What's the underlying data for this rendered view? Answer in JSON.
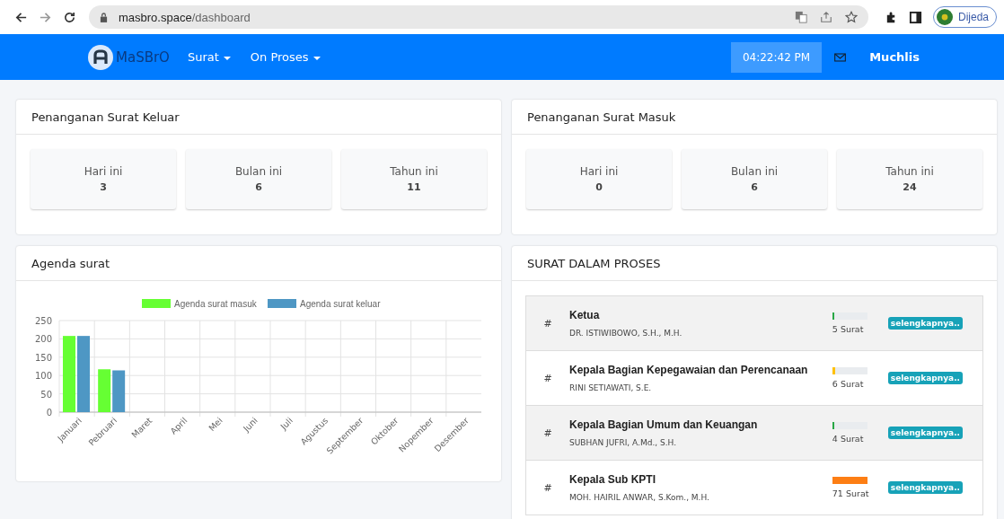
{
  "browser": {
    "url_host": "masbro.space",
    "url_path": "/dashboard",
    "profile": "Dijeda"
  },
  "navbar": {
    "brand": "MaSBrO",
    "menus": [
      "Surat",
      "On Proses"
    ],
    "clock": "04:22:42 PM",
    "user": "Muchlis"
  },
  "stat_cards": [
    {
      "title": "Penanganan Surat Keluar",
      "stats": [
        {
          "label": "Hari ini",
          "value": "3"
        },
        {
          "label": "Bulan ini",
          "value": "6"
        },
        {
          "label": "Tahun ini",
          "value": "11"
        }
      ]
    },
    {
      "title": "Penanganan Surat Masuk",
      "stats": [
        {
          "label": "Hari ini",
          "value": "0"
        },
        {
          "label": "Bulan ini",
          "value": "6"
        },
        {
          "label": "Tahun ini",
          "value": "24"
        }
      ]
    }
  ],
  "agenda": {
    "title": "Agenda surat",
    "chart_data": {
      "type": "bar",
      "categories": [
        "Januari",
        "Pebruari",
        "Maret",
        "April",
        "Mei",
        "Juni",
        "Juli",
        "Agustus",
        "September",
        "Oktober",
        "Nopember",
        "Desember"
      ],
      "series": [
        {
          "name": "Agenda surat masuk",
          "color": "#66ff33",
          "values": [
            208,
            117,
            0,
            0,
            0,
            0,
            0,
            0,
            0,
            0,
            0,
            0
          ]
        },
        {
          "name": "Agenda surat keluar",
          "color": "#4e97c4",
          "values": [
            208,
            114,
            0,
            0,
            0,
            0,
            0,
            0,
            0,
            0,
            0,
            0
          ]
        }
      ],
      "grid": true,
      "legend": true,
      "ylim": [
        0,
        250
      ],
      "yticks": [
        {
          "value": 0,
          "label": "0"
        },
        {
          "value": 50,
          "label": "50"
        },
        {
          "value": 100,
          "label": "100"
        },
        {
          "value": 150,
          "label": "150"
        },
        {
          "value": 200,
          "label": "200"
        },
        {
          "value": 250,
          "label": "250"
        }
      ]
    }
  },
  "proses": {
    "title": "SURAT DALAM PROSES",
    "rows": [
      {
        "mark": "#",
        "title": "Ketua",
        "name": "DR. ISTIWIBOWO, S.H., M.H.",
        "level": 0.02,
        "color": "#28a745",
        "count": "5 Surat",
        "button": "selengkapnya.."
      },
      {
        "mark": "#",
        "title": "Kepala Bagian Kepegawaian dan Perencanaan",
        "name": "RINI SETIAWATI, S.E.",
        "level": 0.08,
        "color": "#ffc107",
        "count": "6 Surat",
        "button": "selengkapnya.."
      },
      {
        "mark": "#",
        "title": "Kepala Bagian Umum dan Keuangan",
        "name": "SUBHAN JUFRI, A.Md., S.H.",
        "level": 0.02,
        "color": "#28a745",
        "count": "4 Surat",
        "button": "selengkapnya.."
      },
      {
        "mark": "#",
        "title": "Kepala Sub KPTI",
        "name": "MOH. HAIRIL ANWAR, S.Kom., M.H.",
        "level": 1,
        "color": "#fd7e14",
        "count": "71 Surat",
        "button": "selengkapnya.."
      }
    ]
  }
}
